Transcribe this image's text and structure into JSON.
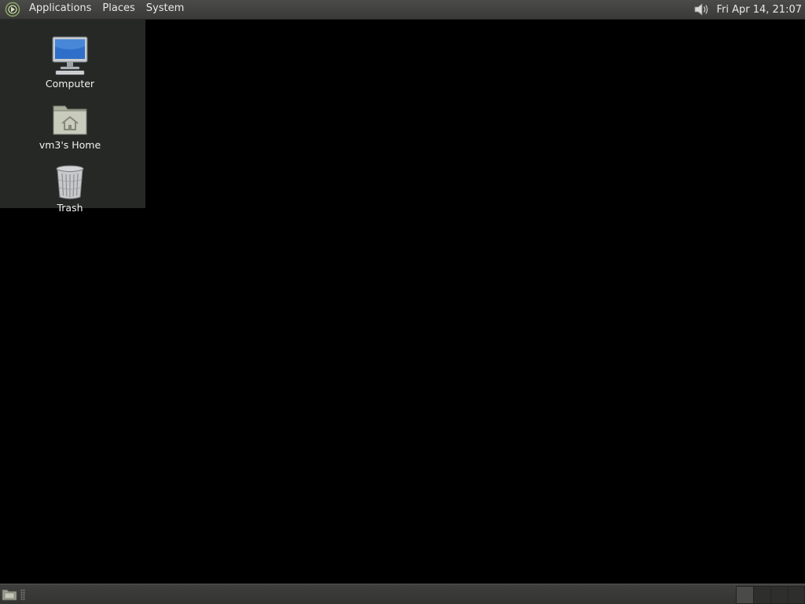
{
  "top_panel": {
    "menus": [
      "Applications",
      "Places",
      "System"
    ],
    "clock": "Fri Apr 14, 21:07"
  },
  "desktop": {
    "icons": [
      {
        "label": "Computer",
        "icon": "computer-icon"
      },
      {
        "label": "vm3's Home",
        "icon": "home-folder-icon"
      },
      {
        "label": "Trash",
        "icon": "trash-icon"
      }
    ]
  },
  "bottom_panel": {
    "workspaces": 4,
    "active_workspace": 1
  }
}
